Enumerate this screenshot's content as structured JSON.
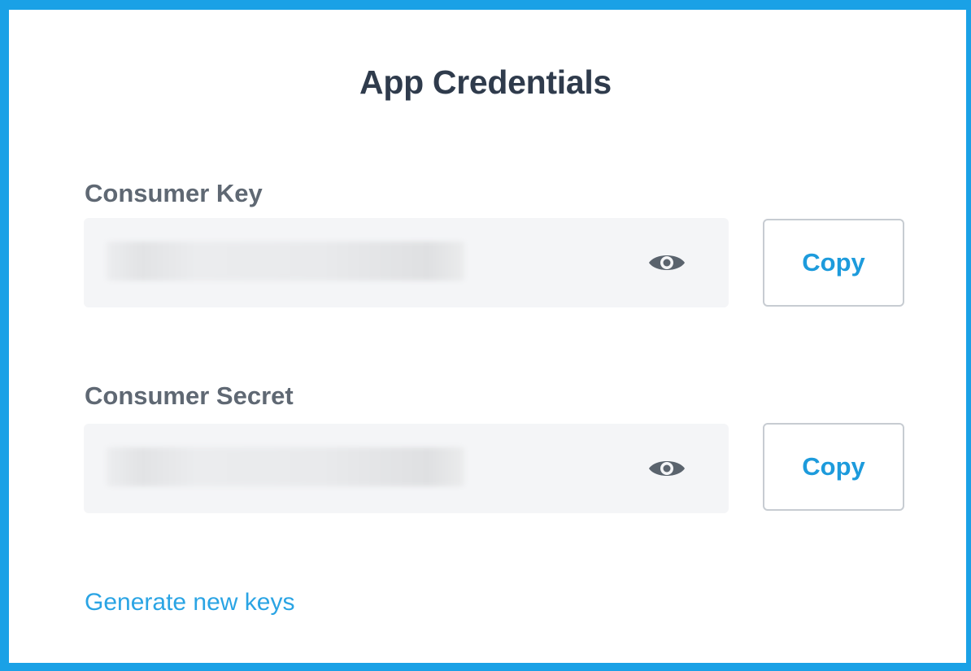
{
  "card": {
    "title": "App Credentials",
    "accent_color": "#1aa1e6"
  },
  "credentials": [
    {
      "label": "Consumer Key",
      "value_state": "masked",
      "reveal_icon": "eye-icon",
      "copy_label": "Copy"
    },
    {
      "label": "Consumer Secret",
      "value_state": "masked",
      "reveal_icon": "eye-icon",
      "copy_label": "Copy"
    }
  ],
  "actions": {
    "generate_label": "Generate new keys",
    "link_color": "#2aa4e4"
  }
}
